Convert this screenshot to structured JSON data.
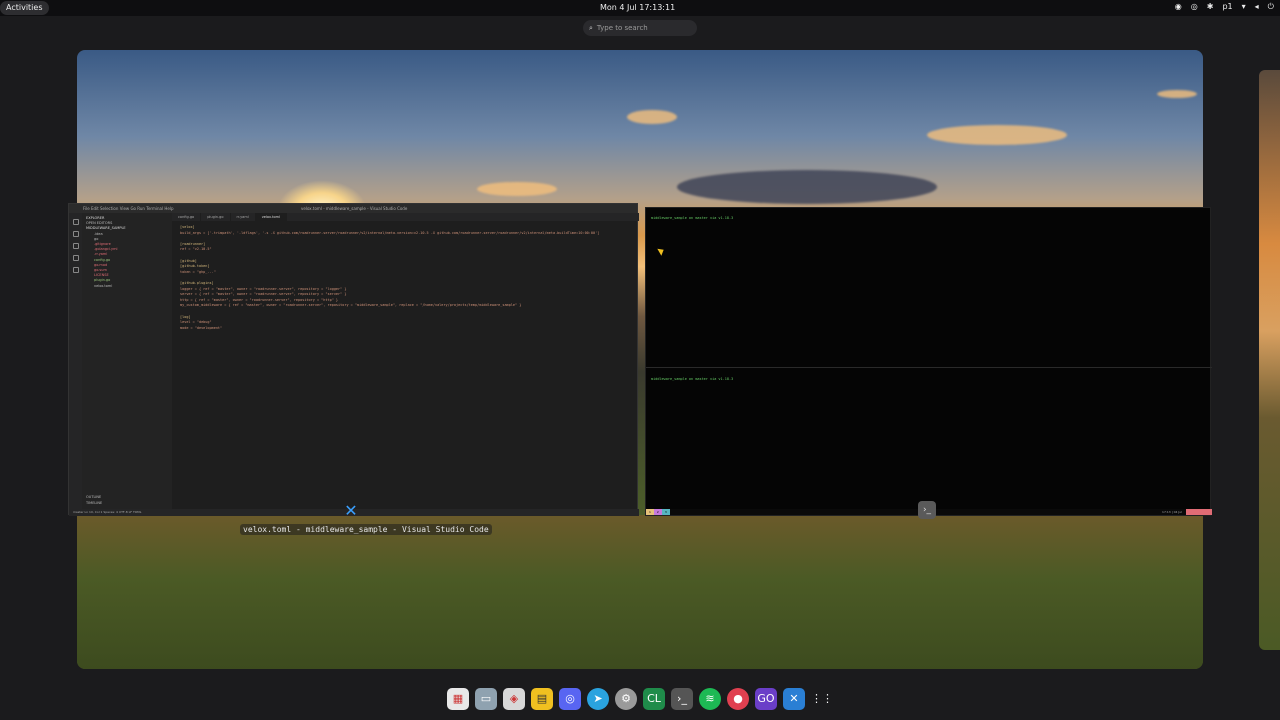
{
  "topbar": {
    "activities": "Activities",
    "clock": "Mon 4 Jul  17:13:11",
    "tray_user": "p1"
  },
  "search": {
    "placeholder": "Type to search"
  },
  "vscode": {
    "title": "velox.toml - middleware_sample - Visual Studio Code",
    "menu": "File  Edit  Selection  View  Go  Run  Terminal  Help",
    "tabs": [
      "config.go",
      "plugin.go",
      "rr.yaml",
      "velox.toml"
    ],
    "explorer": {
      "header": "EXPLORER",
      "open_editors": "OPEN EDITORS",
      "project": "MIDDLEWARE_SAMPLE",
      "files": [
        ".idea",
        "go",
        ".gitignore",
        ".golangci.yml",
        ".rr.yaml",
        "config.go",
        "go.mod",
        "go.sum",
        "LICENSE",
        "plugin.go",
        "velox.toml"
      ],
      "outline": "OUTLINE",
      "timeline": "TIMELINE"
    },
    "editor_lines": [
      "[velox]",
      "build_args = ['-trimpath', '-ldflags', '-s -X github.com/roadrunner-server/roadrunner/v2/internal/meta.version=v2.10.5 -X github.com/roadrunner-server/roadrunner/v2/internal/meta.buildTime=10:00:00']",
      "",
      "[roadrunner]",
      "ref = \"v2.10.5\"",
      "",
      "[github]",
      "[github.token]",
      "token = \"ghp_...\"",
      "",
      "[github.plugins]",
      "logger = { ref = \"master\", owner = \"roadrunner-server\", repository = \"logger\" }",
      "server = { ref = \"master\", owner = \"roadrunner-server\", repository = \"server\" }",
      "http = { ref = \"master\", owner = \"roadrunner-server\", repository = \"http\" }",
      "my_custom_middleware = { ref = \"master\", owner = \"roadrunner-server\", repository = \"middleware_sample\", replace = \"/home/valery/projects/temp/middleware_sample\" }",
      "",
      "[log]",
      "level = \"debug\"",
      "mode = \"development\""
    ],
    "status": "master  Ln 10, Col 1  Spaces: 4  UTF-8  LF  TOML"
  },
  "terminal": {
    "prompt1": "middleware_sample on  master  via  v1.18.3",
    "prompt2": "middleware_sample on  master  via  v1.18.3",
    "tmux_left": [
      "1",
      "2",
      "3"
    ],
    "tmux_right": "17:13 | 04 Jul"
  },
  "caption": "velox.toml - middleware_sample - Visual Studio Code",
  "dock": [
    "calendar",
    "files",
    "software",
    "notes",
    "discord",
    "telegram",
    "settings",
    "clion",
    "terminal",
    "spotify",
    "record",
    "goland",
    "vscode",
    "apps"
  ],
  "colors": {
    "accent": "#3aa0ff",
    "terminal_green": "#66cc66"
  }
}
